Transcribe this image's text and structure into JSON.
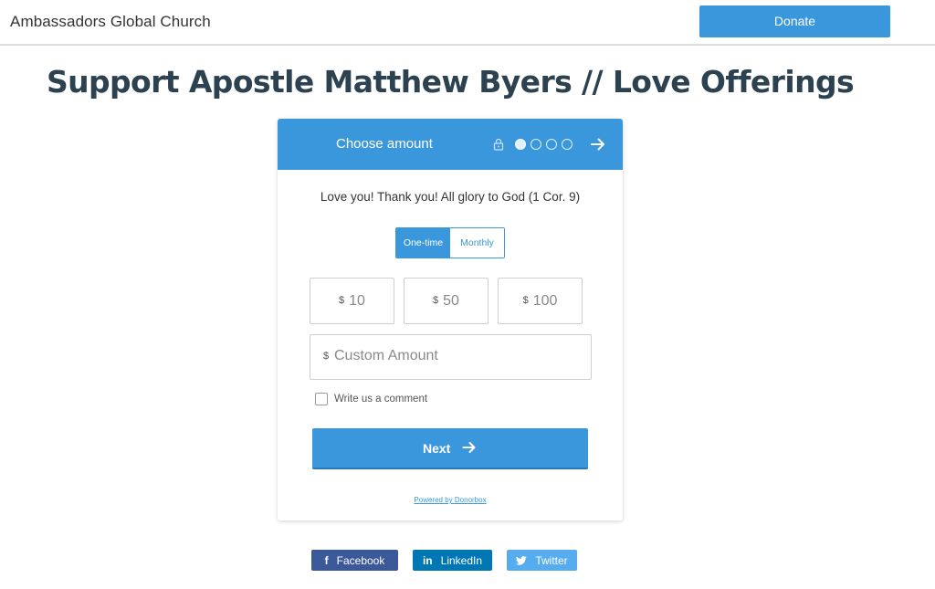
{
  "header": {
    "org_name": "Ambassadors Global Church",
    "donate_label": "Donate"
  },
  "page": {
    "title": "Support Apostle Matthew Byers // Love Offerings"
  },
  "widget": {
    "step_title": "Choose amount",
    "step_current": 1,
    "step_total": 4,
    "message": "Love you! Thank you! All glory to God (1 Cor. 9)",
    "frequency": {
      "options": [
        "One-time",
        "Monthly"
      ],
      "selected": "One-time"
    },
    "currency_symbol": "$",
    "amounts": [
      "10",
      "50",
      "100"
    ],
    "custom_placeholder": "Custom Amount",
    "comment_label": "Write us a comment",
    "comment_checked": false,
    "next_label": "Next",
    "powered_by": "Powered by Donorbox"
  },
  "share": {
    "facebook_label": "Facebook",
    "linkedin_label": "LinkedIn",
    "twitter_label": "Twitter"
  },
  "colors": {
    "accent": "#3b97dc",
    "title": "#2d4251",
    "facebook": "#3b5998",
    "linkedin": "#0077b5",
    "twitter": "#55acee"
  },
  "icons": [
    "lock-icon",
    "arrow-right-icon",
    "facebook-icon",
    "linkedin-icon",
    "twitter-icon"
  ]
}
